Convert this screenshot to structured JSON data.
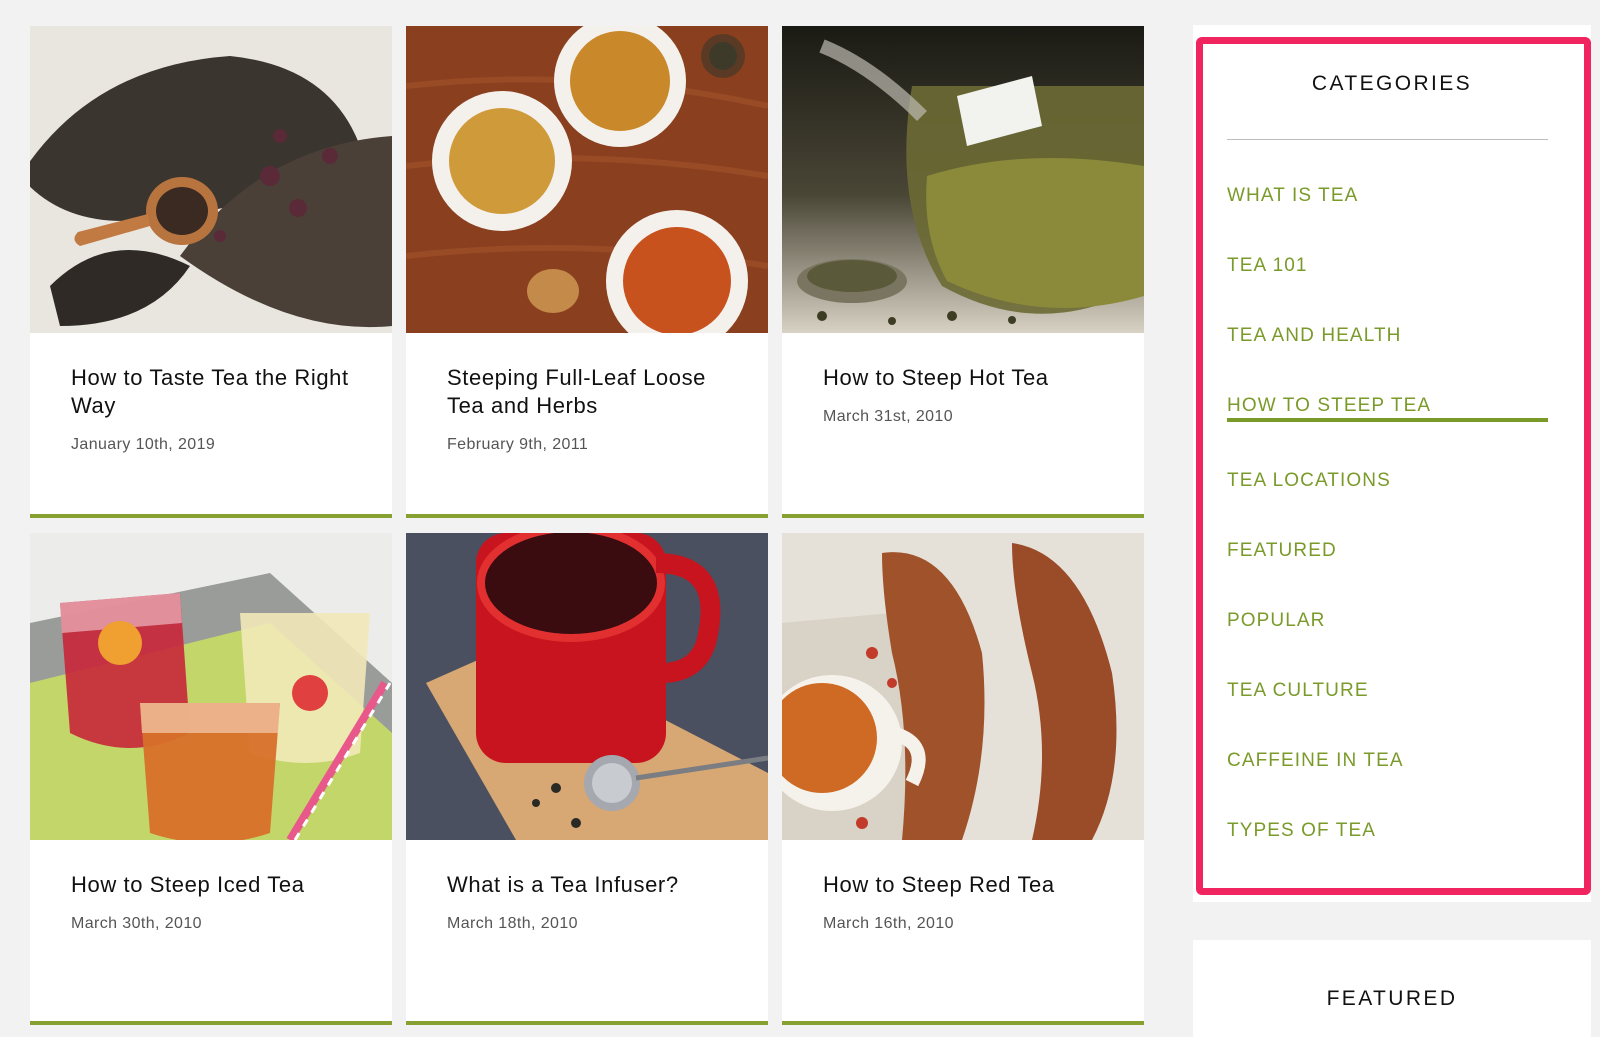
{
  "posts": [
    {
      "title": "How to Taste Tea the Right Way",
      "date": "January 10th, 2019"
    },
    {
      "title": "Steeping Full-Leaf Loose Tea and Herbs",
      "date": "February 9th, 2011"
    },
    {
      "title": "How to Steep Hot Tea",
      "date": "March 31st, 2010"
    },
    {
      "title": "How to Steep Iced Tea",
      "date": "March 30th, 2010"
    },
    {
      "title": "What is a Tea Infuser?",
      "date": "March 18th, 2010"
    },
    {
      "title": "How to Steep Red Tea",
      "date": "March 16th, 2010"
    }
  ],
  "sidebar": {
    "categories_heading": "CATEGORIES",
    "categories": [
      "WHAT IS TEA",
      "TEA 101",
      "TEA AND HEALTH",
      "HOW TO STEEP TEA",
      "TEA LOCATIONS",
      "FEATURED",
      "POPULAR",
      "TEA CULTURE",
      "CAFFEINE IN TEA",
      "TYPES OF TEA"
    ],
    "active_category": "HOW TO STEEP TEA",
    "featured_heading": "FEATURED"
  },
  "colors": {
    "accent_green": "#7a9a2a",
    "highlight_pink": "#f0245f",
    "background": "#f2f2f2"
  }
}
